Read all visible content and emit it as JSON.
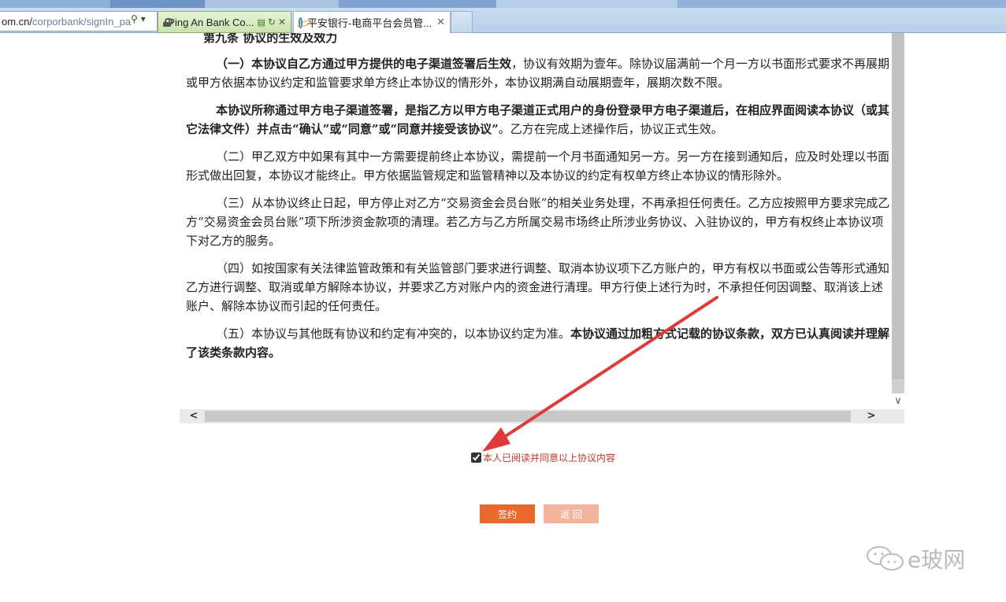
{
  "browser": {
    "address_host": "om.cn/",
    "address_path": "corporbank/signIn_pa",
    "tabs": [
      {
        "label": "Ping An Bank Co...",
        "icons": [
          "lock-icon",
          "page-icon",
          "refresh-icon"
        ]
      },
      {
        "label": "平安银行-电商平台会员管...",
        "close": "✕"
      }
    ]
  },
  "agreement": {
    "article_title": "第九条  协议的生效及效力",
    "paragraphs": [
      {
        "bold_prefix": "（一）本协议自乙方通过甲方提供的电子渠道签署后生效",
        "text": "，协议有效期为壹年。除协议届满前一个月一方以书面形式要求不再展期或甲方依据本协议约定和监管要求单方终止本协议的情形外，本协议期满自动展期壹年，展期次数不限。",
        "bold_suffix": ""
      },
      {
        "bold_prefix": "本协议所称通过甲方电子渠道签署，是指乙方以甲方电子渠道正式用户的身份登录甲方电子渠道后，在相应界面阅读本协议（或其它法律文件）并点击“确认”或“同意”或“同意并接受该协议”",
        "text": "。乙方在完成上述操作后，协议正式生效。",
        "bold_suffix": ""
      },
      {
        "bold_prefix": "",
        "text": "（二）甲乙双方中如果有其中一方需要提前终止本协议，需提前一个月书面通知另一方。另一方在接到通知后，应及时处理以书面形式做出回复，本协议才能终止。甲方依据监管规定和监管精神以及本协议的约定有权单方终止本协议的情形除外。",
        "bold_suffix": ""
      },
      {
        "bold_prefix": "",
        "text": "（三）从本协议终止日起，甲方停止对乙方“交易资金会员台账”的相关业务处理，不再承担任何责任。乙方应按照甲方要求完成乙方“交易资金会员台账”项下所涉资金款项的清理。若乙方与乙方所属交易市场终止所涉业务协议、入驻协议的，甲方有权终止本协议项下对乙方的服务。",
        "bold_suffix": ""
      },
      {
        "bold_prefix": "",
        "text": "（四）如按国家有关法律监管政策和有关监管部门要求进行调整、取消本协议项下乙方账户的，甲方有权以书面或公告等形式通知乙方进行调整、取消或单方解除本协议，并要求乙方对账户内的资金进行清理。甲方行使上述行为时，不承担任何因调整、取消该上述账户、解除本协议而引起的任何责任。",
        "bold_suffix": ""
      },
      {
        "bold_prefix": "",
        "text": "（五）本协议与其他既有协议和约定有冲突的，以本协议约定为准。",
        "bold_suffix": "本协议通过加粗方式记载的协议条款，双方已认真阅读并理解了该类条款内容。"
      }
    ],
    "scroll_left": "<",
    "scroll_right": ">",
    "scroll_down": "∨"
  },
  "consent": {
    "checked": true,
    "label": "本人已阅读并同意以上协议内容"
  },
  "buttons": {
    "sign": "签约",
    "back": "返 回"
  },
  "watermark": {
    "text": "e玻网",
    "icon": "chat-bubbles-icon"
  },
  "colors": {
    "sign_button": "#e8692b",
    "back_button": "#f4b39a",
    "consent_text": "#c0392b",
    "annotation_arrow": "#e0393a"
  }
}
